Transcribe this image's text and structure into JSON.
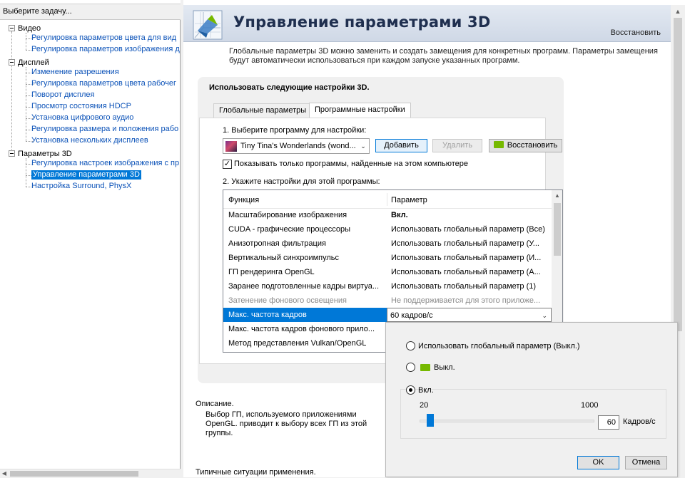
{
  "tree": {
    "header": "Выберите задачу...",
    "groups": [
      {
        "label": "Видео",
        "items": [
          "Регулировка параметров цвета для вид",
          "Регулировка параметров изображения д"
        ]
      },
      {
        "label": "Дисплей",
        "items": [
          "Изменение разрешения",
          "Регулировка параметров цвета рабочег",
          "Поворот дисплея",
          "Просмотр состояния HDCP",
          "Установка цифрового аудио",
          "Регулировка размера и положения рабо",
          "Установка нескольких дисплеев"
        ]
      },
      {
        "label": "Параметры 3D",
        "items": [
          "Регулировка настроек изображения с пр",
          "Управление параметрами 3D",
          "Настройка Surround, PhysX"
        ]
      }
    ],
    "selected": "Управление параметрами 3D"
  },
  "header": {
    "title": "Управление параметрами 3D",
    "restore": "Восстановить"
  },
  "intro": "Глобальные параметры 3D можно заменить и создать замещения для конкретных программ. Параметры замещения будут автоматически использоваться при каждом запуске указанных программ.",
  "settings": {
    "title": "Использовать следующие настройки 3D.",
    "tabs": [
      "Глобальные параметры",
      "Программные настройки"
    ],
    "active_tab": "Программные настройки",
    "step1": "1. Выберите программу для настройки:",
    "program": "Tiny Tina's Wonderlands (wond...",
    "add_button": "Добавить",
    "remove_button": "Удалить",
    "restore_button": "Восстановить",
    "show_found_only": "Показывать только программы, найденные на этом компьютере",
    "show_found_checked": true,
    "step2": "2. Укажите настройки для этой программы:",
    "columns": [
      "Функция",
      "Параметр"
    ],
    "rows": [
      {
        "feature": "Масштабирование изображения",
        "value": "Вкл."
      },
      {
        "feature": "CUDA - графические процессоры",
        "value": "Использовать глобальный параметр (Все)"
      },
      {
        "feature": "Анизотропная фильтрация",
        "value": "Использовать глобальный параметр (У..."
      },
      {
        "feature": "Вертикальный синхроимпульс",
        "value": "Использовать глобальный параметр (И..."
      },
      {
        "feature": "ГП рендеринга OpenGL",
        "value": "Использовать глобальный параметр (А..."
      },
      {
        "feature": "Заранее подготовленные кадры виртуа...",
        "value": "Использовать глобальный параметр (1)"
      },
      {
        "feature": "Затенение фонового освещения",
        "value": "Не поддерживается для этого приложе..."
      },
      {
        "feature": "Макс. частота кадров",
        "value": "60 кадров/с"
      },
      {
        "feature": "Макс. частота кадров фонового прило...",
        "value": ""
      },
      {
        "feature": "Метод представления Vulkan/OpenGL",
        "value": ""
      }
    ]
  },
  "description": {
    "title": "Описание.",
    "text": "Выбор ГП, используемого приложениями OpenGL. приводит к выбору всех ГП из этой группы.",
    "typical": "Типичные ситуации применения."
  },
  "popup": {
    "option_global": "Использовать глобальный параметр (Выкл.)",
    "option_off": "Выкл.",
    "option_on": "Вкл.",
    "selected_option": "Вкл.",
    "slider_min": "20",
    "slider_max": "1000",
    "value": "60",
    "value_fraction": 0.041,
    "unit": "Кадров/с",
    "ok": "OK",
    "cancel": "Отмена"
  },
  "colors": {
    "selection": "#0078d7",
    "link": "#0b52b8",
    "nvidia_green": "#76b900"
  }
}
